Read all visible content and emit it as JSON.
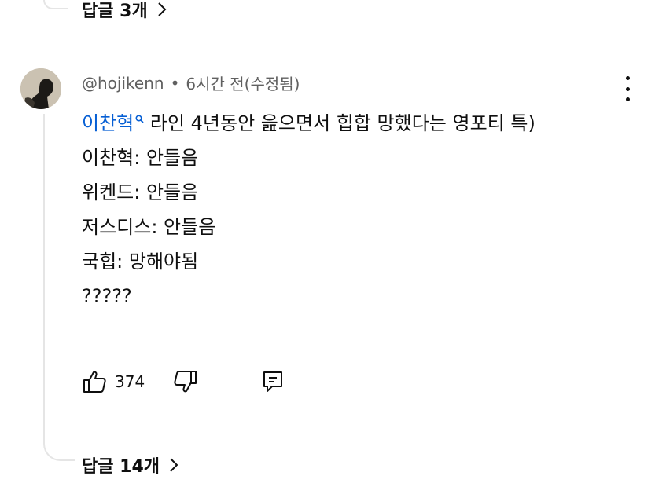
{
  "thread": {
    "top_replies_label": "답글 3개",
    "bottom_replies_label": "답글 14개"
  },
  "comment": {
    "author": "@hojikenn",
    "separator": "•",
    "time": "6시간 전(수정됨)",
    "mention": "이찬혁",
    "mention_icon": "search-icon",
    "first_line_text": " 라인 4년동안 읊으면서 힙합 망했다는 영포티 특)",
    "lines": [
      "이찬혁: 안들음",
      "위켄드: 안들음",
      "저스디스: 안들음",
      "국힙: 망해야됨",
      "?????"
    ],
    "like_count": "374"
  },
  "icons": {
    "like": "thumbs-up-icon",
    "dislike": "thumbs-down-icon",
    "reply": "reply-comment-icon",
    "menu": "more-vertical-icon",
    "chevron": "chevron-right-icon"
  },
  "colors": {
    "mention": "#065fd4",
    "meta": "#606060",
    "text": "#0f0f0f",
    "thread_line": "#e5e5e5"
  }
}
